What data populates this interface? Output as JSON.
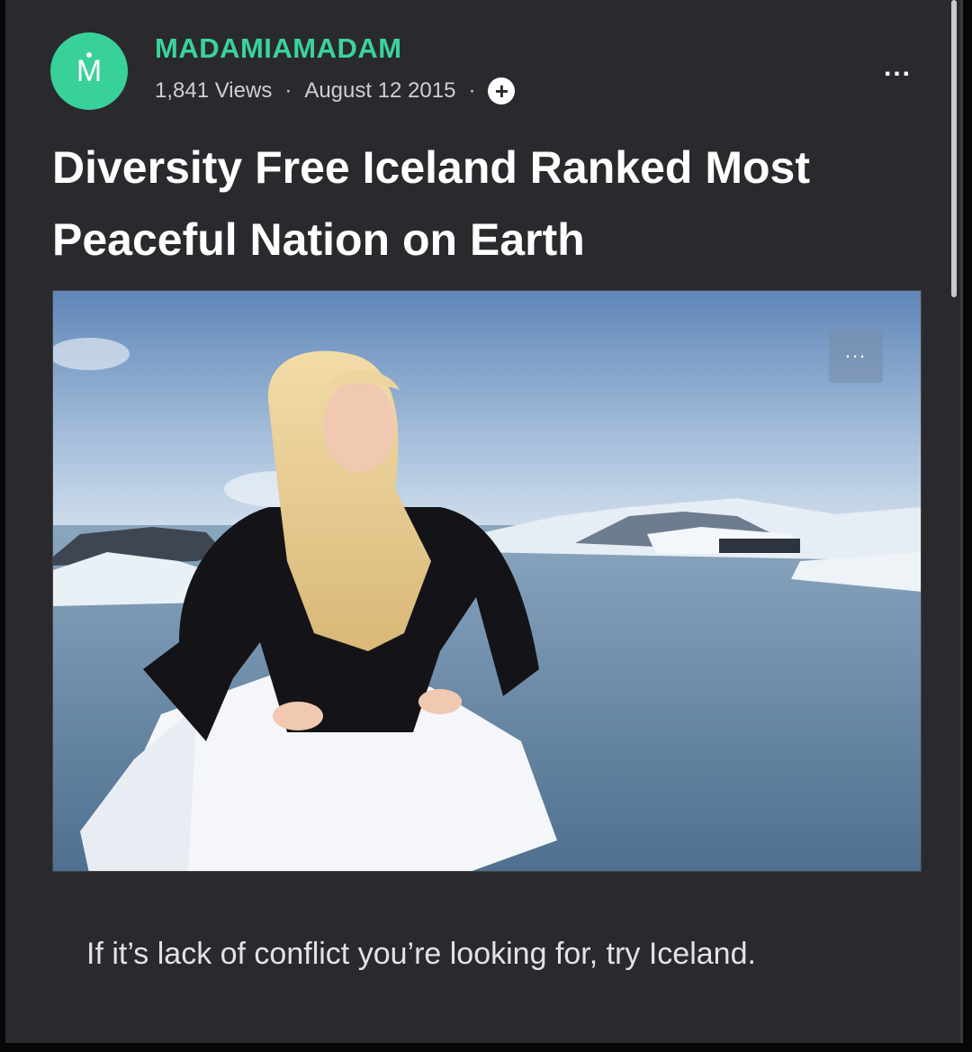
{
  "post": {
    "avatar_letter": "M",
    "author": "MADAMIAMADAM",
    "views": "1,841 Views",
    "separator": "·",
    "date": "August 12 2015",
    "follow_symbol": "+",
    "more_symbol": "...",
    "headline": "Diversity Free Iceland Ranked Most Peaceful Nation on Earth",
    "image": {
      "description_icon": "photo-image",
      "more_symbol": "..."
    },
    "body": "If it’s lack of conflict you’re looking for, try Iceland."
  },
  "colors": {
    "background": "#2a2a2e",
    "accent": "#3ad39b",
    "text": "#ffffff"
  }
}
